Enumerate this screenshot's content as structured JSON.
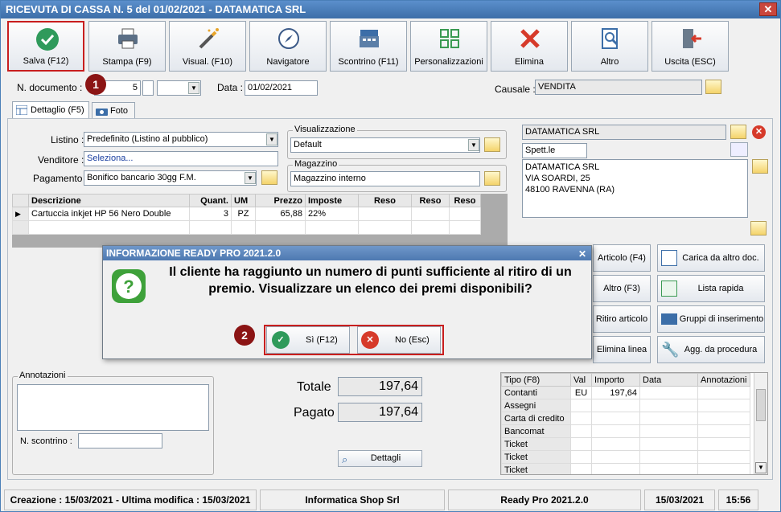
{
  "window": {
    "title": "RICEVUTA DI CASSA N. 5 del 01/02/2021 - DATAMATICA SRL"
  },
  "toolbar": [
    {
      "label": "Salva (F12)",
      "icon": "check-icon"
    },
    {
      "label": "Stampa (F9)",
      "icon": "printer-icon"
    },
    {
      "label": "Visual. (F10)",
      "icon": "magic-wand-icon"
    },
    {
      "label": "Navigatore",
      "icon": "compass-icon"
    },
    {
      "label": "Scontrino (F11)",
      "icon": "cash-register-icon"
    },
    {
      "label": "Personalizzazioni",
      "icon": "grid-icon"
    },
    {
      "label": "Elimina",
      "icon": "delete-x-icon"
    },
    {
      "label": "Altro",
      "icon": "search-doc-icon"
    },
    {
      "label": "Uscita (ESC)",
      "icon": "exit-door-icon"
    }
  ],
  "header": {
    "doc_label": "N. documento :",
    "doc_number": "5",
    "data_label": "Data :",
    "data_value": "01/02/2021",
    "causale_label": "Causale :",
    "causale_value": "VENDITA"
  },
  "badges": {
    "one": "1",
    "two": "2"
  },
  "tabs": [
    {
      "label": "Dettaglio (F5)"
    },
    {
      "label": "Foto"
    }
  ],
  "form": {
    "listino_label": "Listino :",
    "listino_value": "Predefinito (Listino al pubblico)",
    "venditore_label": "Venditore :",
    "venditore_value": "Seleziona...",
    "pagamento_label": "Pagamento :",
    "pagamento_value": "Bonifico bancario 30gg F.M.",
    "visualizzazione_title": "Visualizzazione",
    "visualizzazione_value": "Default",
    "magazzino_title": "Magazzino",
    "magazzino_value": "Magazzino interno"
  },
  "customer": {
    "name": "DATAMATICA SRL",
    "title": "Spett.le",
    "address_lines": [
      "DATAMATICA SRL",
      "VIA SOARDI, 25",
      "48100 RAVENNA (RA)"
    ]
  },
  "items_table": {
    "headers": [
      "Descrizione",
      "Quant.",
      "UM",
      "Prezzo",
      "Imposte",
      "Reso",
      "Reso",
      "Reso"
    ],
    "rows": [
      [
        "Cartuccia inkjet HP 56 Nero Double",
        "3",
        "PZ",
        "65,88",
        "22%",
        "",
        "",
        ""
      ]
    ]
  },
  "right_buttons": [
    {
      "label": "Articolo (F4)"
    },
    {
      "label": "Carica da altro doc."
    },
    {
      "label": "Altro (F3)"
    },
    {
      "label": "Lista rapida"
    },
    {
      "label": "Ritiro articolo"
    },
    {
      "label": "Gruppi di inserimento"
    },
    {
      "label": "Elimina linea"
    },
    {
      "label": "Agg. da procedura"
    }
  ],
  "dialog": {
    "title": "INFORMAZIONE READY PRO 2021.2.0",
    "message": "Il cliente ha raggiunto un numero di punti sufficiente al ritiro di un premio. Visualizzare un elenco dei premi disponibili?",
    "yes_label": "Sì (F12)",
    "no_label": "No (Esc)"
  },
  "notes": {
    "title": "Annotazioni",
    "scontrino_label": "N. scontrino :"
  },
  "totals": {
    "totale_label": "Totale",
    "totale_value": "197,64",
    "pagato_label": "Pagato",
    "pagato_value": "197,64",
    "dettagli_label": "Dettagli"
  },
  "payments": {
    "headers": [
      "Tipo (F8)",
      "Val",
      "Importo",
      "Data",
      "Annotazioni"
    ],
    "rows": [
      [
        "Contanti",
        "EU",
        "197,64",
        "",
        ""
      ],
      [
        "Assegni",
        "",
        "",
        "",
        ""
      ],
      [
        "Carta di credito",
        "",
        "",
        "",
        ""
      ],
      [
        "Bancomat",
        "",
        "",
        "",
        ""
      ],
      [
        "Ticket",
        "",
        "",
        "",
        ""
      ],
      [
        "Ticket",
        "",
        "",
        "",
        ""
      ],
      [
        "Ticket",
        "",
        "",
        "",
        ""
      ]
    ]
  },
  "status": {
    "dates": "Creazione : 15/03/2021 - Ultima modifica : 15/03/2021",
    "company": "Informatica Shop Srl",
    "product": "Ready Pro 2021.2.0",
    "date": "15/03/2021",
    "time": "15:56"
  },
  "colors": {
    "accent": "#3c6ea8",
    "highlight": "#c81e1e",
    "badge": "#8b1414"
  }
}
